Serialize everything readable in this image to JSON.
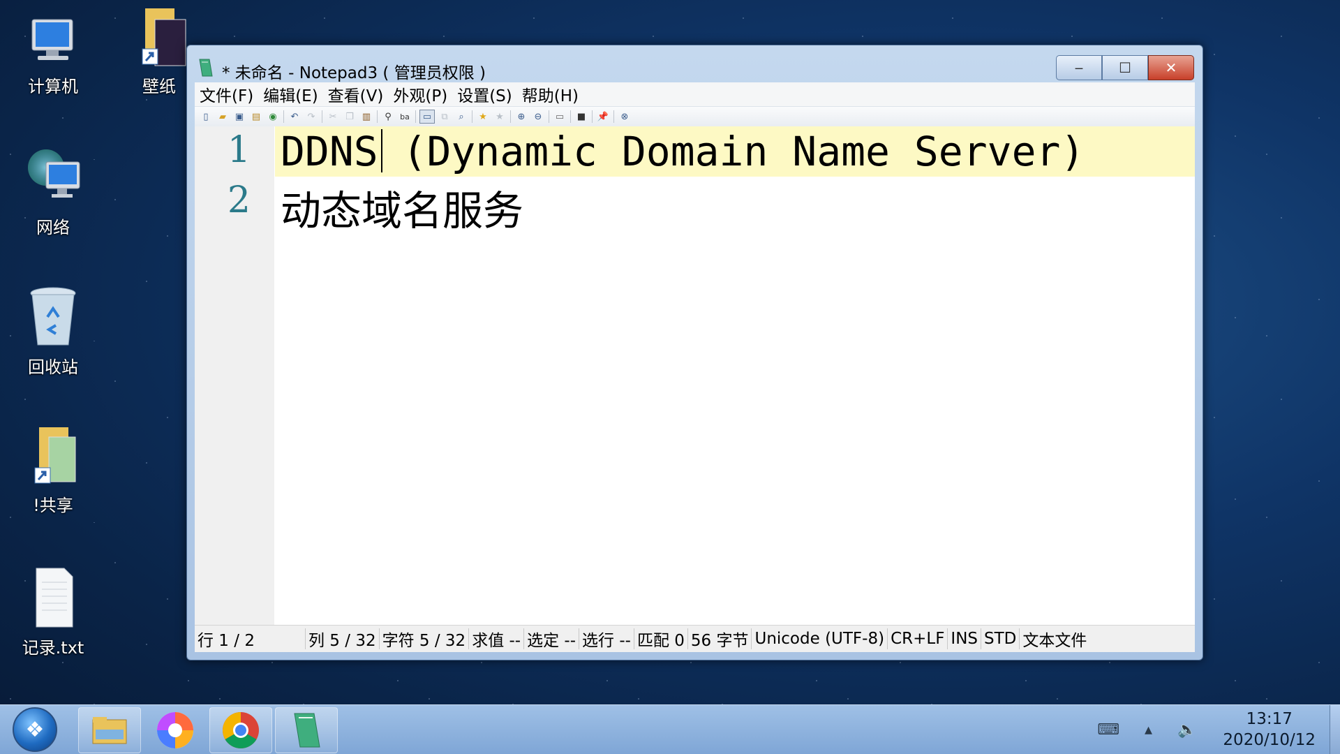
{
  "desktop": {
    "icons": [
      {
        "label": "计算机"
      },
      {
        "label": "壁纸"
      },
      {
        "label": "网络"
      },
      {
        "label": "回收站"
      },
      {
        "label": "!共享"
      },
      {
        "label": "记录.txt"
      }
    ]
  },
  "window": {
    "title": "* 未命名 - Notepad3 ( 管理员权限 )",
    "buttons": {
      "minimize": "‒",
      "maximize": "☐",
      "close": "✕"
    },
    "menu": [
      "文件(F)",
      "编辑(E)",
      "查看(V)",
      "外观(P)",
      "设置(S)",
      "帮助(H)"
    ],
    "toolbar_icons": [
      "new-icon",
      "open-icon",
      "save-icon",
      "save-as-icon",
      "browse-icon",
      "undo-icon",
      "redo-icon",
      "cut-icon",
      "copy-icon",
      "paste-icon",
      "find-icon",
      "replace-icon",
      "wordwrap-icon",
      "select-all-icon",
      "zoom-find-icon",
      "favorite-add-icon",
      "favorite-icon",
      "zoom-in-icon",
      "zoom-out-icon",
      "scheme-icon",
      "fullscreen-icon",
      "pin-icon",
      "close-doc-icon"
    ],
    "editor": {
      "lines": [
        {
          "number": "1",
          "text": "DDNS (Dynamic Domain Name Server)"
        },
        {
          "number": "2",
          "text": "动态域名服务"
        }
      ]
    },
    "status": {
      "line": "行 1 / 2",
      "col": "列 5 / 32",
      "chars": "字符 5 / 32",
      "sum": "求值 --",
      "sel": "选定 --",
      "sel_lines": "选行 --",
      "match": "匹配 0",
      "bytes": "56 字节",
      "encoding": "Unicode (UTF-8)",
      "eol": "CR+LF",
      "ins": "INS",
      "std": "STD",
      "type": "文本文件"
    }
  },
  "taskbar": {
    "apps": [
      "file-explorer-icon",
      "pinwheel-app-icon",
      "chrome-icon",
      "notepad3-icon"
    ],
    "clock_time": "13:17",
    "clock_date": "2020/10/12"
  }
}
